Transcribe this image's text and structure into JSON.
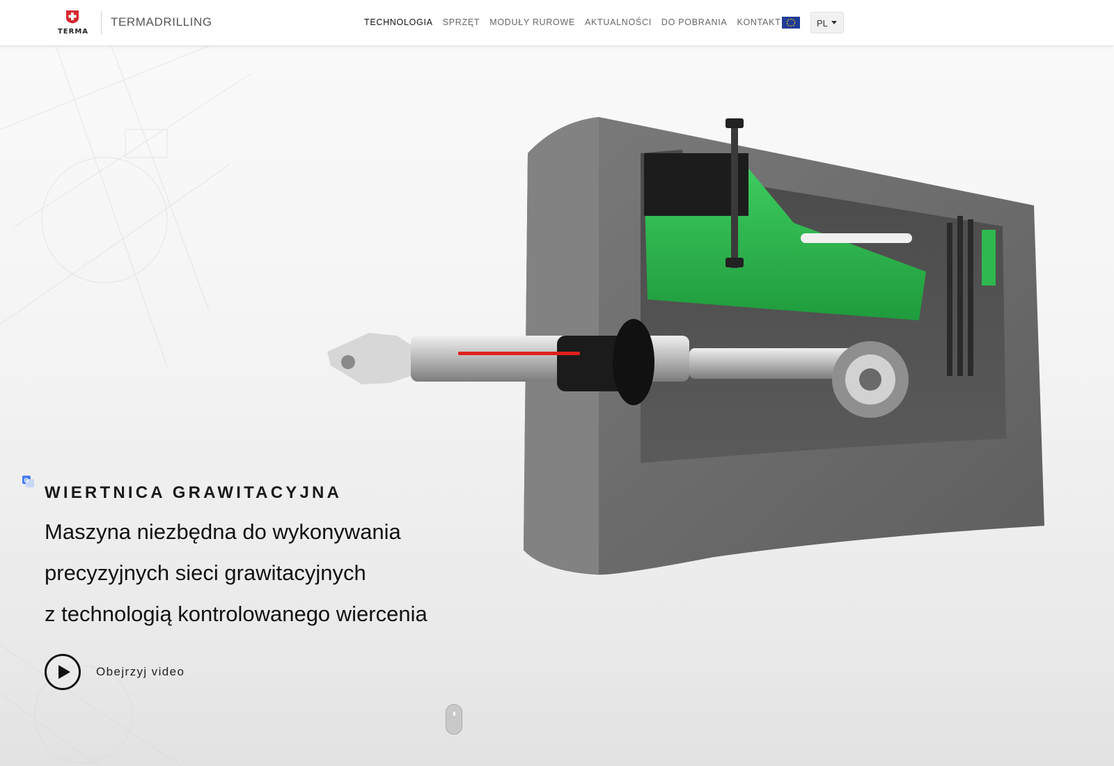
{
  "header": {
    "logo_text": "TERMA",
    "brand_name": "TERMADRILLING",
    "nav": [
      {
        "label": "TECHNOLOGIA",
        "active": true
      },
      {
        "label": "SPRZĘT",
        "active": false
      },
      {
        "label": "MODUŁY RUROWE",
        "active": false
      },
      {
        "label": "AKTUALNOŚCI",
        "active": false
      },
      {
        "label": "DO POBRANIA",
        "active": false
      },
      {
        "label": "KONTAKT",
        "active": false
      }
    ],
    "flag_icon": "eu-flag-icon",
    "language": {
      "selected": "PL"
    }
  },
  "hero": {
    "kicker": "WIERTNICA GRAWITACYJNA",
    "lines": [
      "Maszyna niezbędna do wykonywania",
      "precyzyjnych sieci grawitacyjnych",
      "z technologią kontrolowanego wiercenia"
    ],
    "watch_label": "Obejrzyj video"
  },
  "colors": {
    "accent_green": "#2eb84f",
    "laser_red": "#e0201c",
    "concrete": "#6f6f6f",
    "logo_red": "#d8282e"
  },
  "icons": {
    "translate": "google-translate-icon",
    "play": "play-icon",
    "scroll": "scroll-mouse-icon"
  }
}
